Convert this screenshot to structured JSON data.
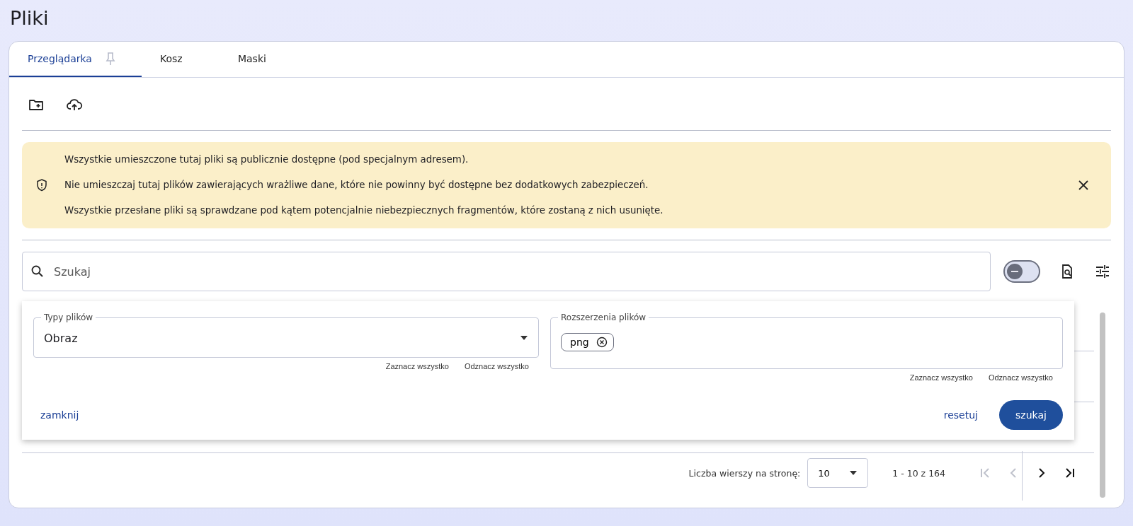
{
  "page_title": "Pliki",
  "tabs": [
    {
      "label": "Przeglądarka",
      "selected": true,
      "pinned": true
    },
    {
      "label": "Kosz",
      "selected": false,
      "pinned": false
    },
    {
      "label": "Maski",
      "selected": false,
      "pinned": false
    }
  ],
  "alert": {
    "lines": [
      "Wszystkie umieszczone tutaj pliki są publicznie dostępne (pod specjalnym adresem).",
      "Nie umieszczaj tutaj plików zawierających wrażliwe dane, które nie powinny być dostępne bez dodatkowych zabezpieczeń.",
      "Wszystkie przesłane pliki są sprawdzane pod kątem potencjalnie niebezpiecznych fragmentów, które zostaną z nich usunięte."
    ]
  },
  "search": {
    "placeholder": "Szukaj"
  },
  "toggle": {
    "indeterminate": true
  },
  "filters": {
    "file_types": {
      "label": "Typy plików",
      "value": "Obraz",
      "select_all": "Zaznacz wszystko",
      "deselect_all": "Odznacz wszystko"
    },
    "extensions": {
      "label": "Rozszerzenia plików",
      "chips": [
        "png"
      ],
      "select_all": "Zaznacz wszystko",
      "deselect_all": "Odznacz wszystko"
    },
    "close": "zamknij",
    "reset": "resetuj",
    "search": "szukaj"
  },
  "pagination": {
    "rows_label": "Liczba wierszy na stronę:",
    "rows_value": "10",
    "range": "1 - 10 z 164",
    "buttons": [
      {
        "kind": "first",
        "disabled": true
      },
      {
        "kind": "prev",
        "disabled": true
      },
      {
        "kind": "next",
        "disabled": false
      },
      {
        "kind": "last",
        "disabled": false
      }
    ]
  }
}
